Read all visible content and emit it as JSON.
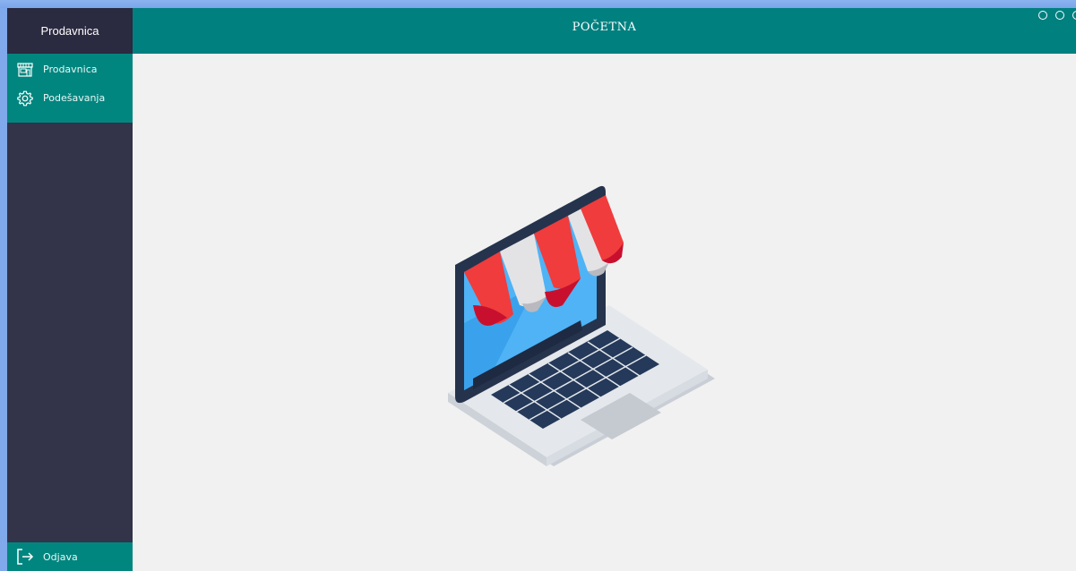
{
  "sidebar": {
    "brand": "Prodavnica",
    "items": [
      {
        "label": "Prodavnica",
        "icon": "shop-icon"
      },
      {
        "label": "Podešavanja",
        "icon": "gear-icon"
      }
    ],
    "logout": {
      "label": "Odjava",
      "icon": "logout-icon"
    }
  },
  "header": {
    "title": "POČETNA"
  },
  "colors": {
    "teal": "#00807f",
    "sidebar_dark": "#33334a",
    "brand_dark": "#2a2a40",
    "content_bg": "#f1f1f1",
    "desktop": "#7fa9ea"
  },
  "main": {
    "illustration": "laptop-shop-illustration"
  }
}
